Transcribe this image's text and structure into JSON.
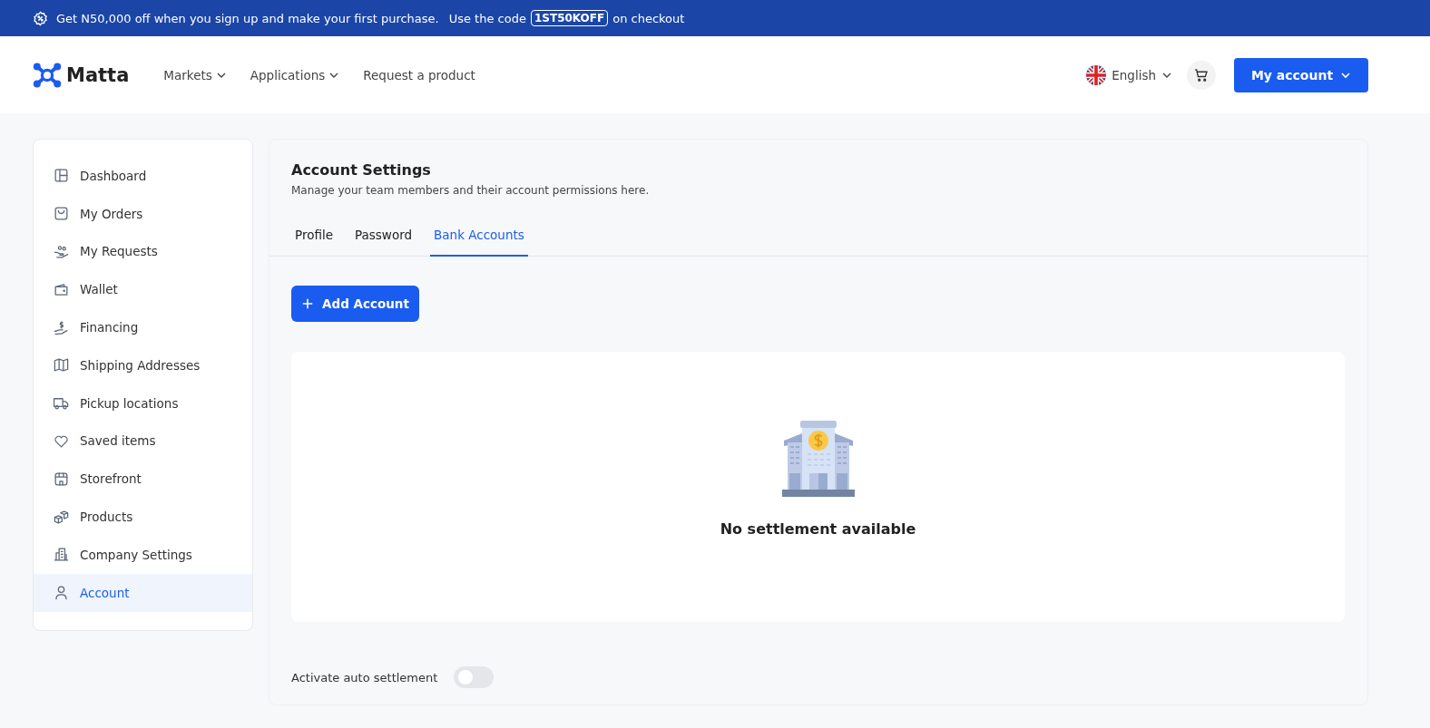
{
  "promo_banner": {
    "text": "Get N50,000 off when you sign up and make your first purchase.",
    "code_prefix": "Use the code",
    "code": "1ST50KOFF",
    "code_suffix": "on checkout"
  },
  "header": {
    "logo": "Matta",
    "nav": [
      {
        "label": "Markets",
        "dropdown": true
      },
      {
        "label": "Applications",
        "dropdown": true
      },
      {
        "label": "Request a product",
        "dropdown": false
      }
    ],
    "language": "English",
    "account_button": "My account"
  },
  "sidebar": {
    "items": [
      {
        "label": "Dashboard",
        "selected": false
      },
      {
        "label": "My Orders",
        "selected": false
      },
      {
        "label": "My Requests",
        "selected": false
      },
      {
        "label": "Wallet",
        "selected": false
      },
      {
        "label": "Financing",
        "selected": false
      },
      {
        "label": "Shipping Addresses",
        "selected": false
      },
      {
        "label": "Pickup locations",
        "selected": false
      },
      {
        "label": "Saved items",
        "selected": false
      },
      {
        "label": "Storefront",
        "selected": false
      },
      {
        "label": "Products",
        "selected": false
      },
      {
        "label": "Company Settings",
        "selected": false
      },
      {
        "label": "Account",
        "selected": true
      }
    ]
  },
  "main": {
    "title": "Account Settings",
    "subtitle": "Manage your team members and their account permissions here.",
    "tabs": [
      {
        "label": "Profile",
        "selected": false
      },
      {
        "label": "Password",
        "selected": false
      },
      {
        "label": "Bank Accounts",
        "selected": true
      }
    ],
    "add_button": "Add Account",
    "empty_message": "No settlement available",
    "auto_settlement": {
      "label": "Activate auto settlement",
      "on": false
    }
  }
}
